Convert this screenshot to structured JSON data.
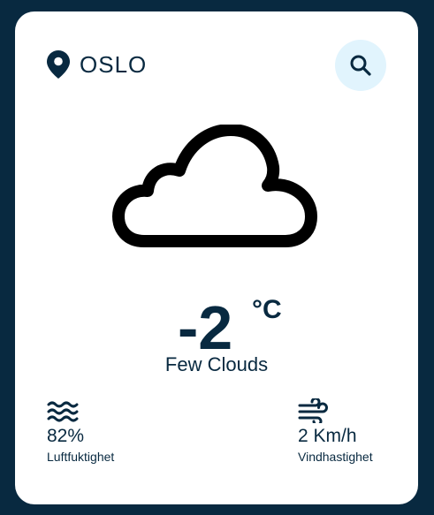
{
  "location": {
    "city": "OSLO",
    "icon": "location-pin-icon"
  },
  "search": {
    "icon": "search-icon"
  },
  "weather": {
    "icon": "cloud-icon",
    "temperature": "-2",
    "unit": "°C",
    "condition": "Few Clouds"
  },
  "stats": {
    "humidity": {
      "icon": "humidity-waves-icon",
      "value": "82%",
      "label": "Luftfuktighet"
    },
    "wind": {
      "icon": "wind-icon",
      "value": "2 Km/h",
      "label": "Vindhastighet"
    }
  },
  "colors": {
    "background": "#082940",
    "card": "#ffffff",
    "text": "#082940",
    "search_button_bg": "#e1f4fd"
  }
}
